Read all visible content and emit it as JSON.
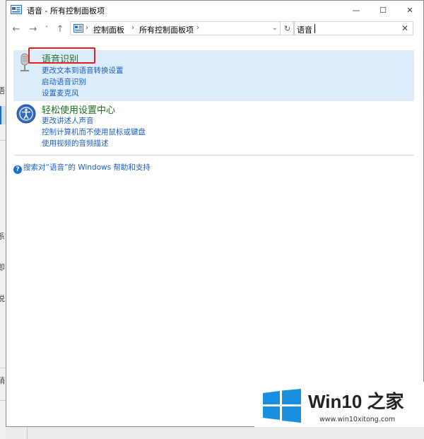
{
  "window": {
    "title": "语音 - 所有控制面板项"
  },
  "titlebar": {
    "minimize": "—",
    "maximize": "☐",
    "close": "✕"
  },
  "nav": {
    "back": "←",
    "forward": "→",
    "recent": "˅",
    "up": "↑"
  },
  "address": {
    "crumbs": [
      "控制面板",
      "所有控制面板项"
    ],
    "separator": "›",
    "dropdown": "⌄",
    "refresh": "↻"
  },
  "search": {
    "value": "语音",
    "clear": "✕"
  },
  "groups": [
    {
      "title": "语音识别",
      "icon": "microphone-icon",
      "highlighted": true,
      "links": [
        "更改文本到语音转换设置",
        "启动语音识别",
        "设置麦克风"
      ]
    },
    {
      "title": "轻松使用设置中心",
      "icon": "ease-of-access-icon",
      "highlighted": false,
      "links": [
        "更改讲述人声音",
        "控制计算机而不使用鼠标或键盘",
        "使用视频的音频描述"
      ]
    }
  ],
  "help": {
    "icon": "help-icon",
    "text": "搜索对“语音”的 Windows 帮助和支持"
  },
  "watermark": {
    "title": "Win10 之家",
    "url": "www.win10xitong.com"
  },
  "background": {
    "fragments": [
      "语",
      "系",
      "即",
      "说",
      "硝"
    ]
  },
  "colors": {
    "highlight": "#dcecfa",
    "link": "#1a5fc0",
    "group_title": "#1e6e1e",
    "annotation_box": "#e02020",
    "win_logo": "#1a8fe0"
  }
}
